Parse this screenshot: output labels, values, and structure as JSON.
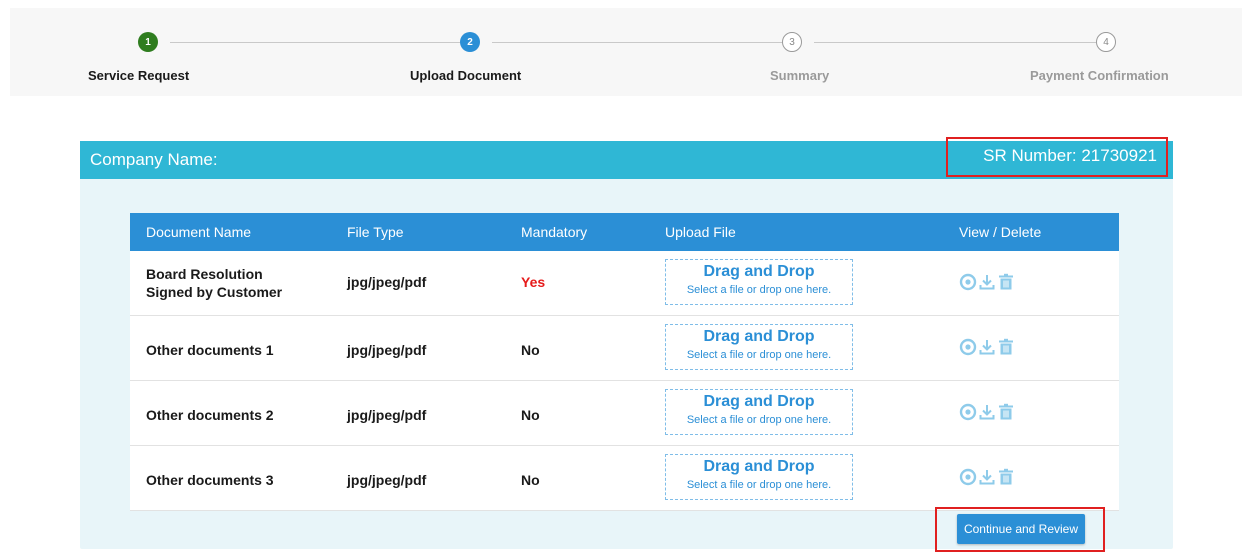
{
  "stepper": {
    "steps": [
      {
        "number": "1",
        "label": "Service Request",
        "state": "done"
      },
      {
        "number": "2",
        "label": "Upload Document",
        "state": "active"
      },
      {
        "number": "3",
        "label": "Summary",
        "state": "todo"
      },
      {
        "number": "4",
        "label": "Payment Confirmation",
        "state": "todo"
      }
    ]
  },
  "panel": {
    "company_label": "Company Name:",
    "sr_number": "SR Number: 21730921"
  },
  "table": {
    "headers": [
      "Document Name",
      "File Type",
      "Mandatory",
      "Upload File",
      "View / Delete"
    ],
    "rows": [
      {
        "doc_name": "Board Resolution Signed by Customer",
        "file_type": "jpg/jpeg/pdf",
        "mandatory": "Yes"
      },
      {
        "doc_name": "Other documents 1",
        "file_type": "jpg/jpeg/pdf",
        "mandatory": "No"
      },
      {
        "doc_name": "Other documents 2",
        "file_type": "jpg/jpeg/pdf",
        "mandatory": "No"
      },
      {
        "doc_name": "Other documents 3",
        "file_type": "jpg/jpeg/pdf",
        "mandatory": "No"
      }
    ],
    "dropzone": {
      "title": "Drag and Drop",
      "subtitle": "Select a file or drop one here."
    }
  },
  "actions": {
    "continue_label": "Continue and Review"
  },
  "colors": {
    "header_bar": "#2fb7d5",
    "table_header": "#2b8fd6",
    "mandatory_yes": "#e61b1b",
    "step_done": "#2f7d1f",
    "highlight_box": "#e02020"
  },
  "icons": [
    "view-icon",
    "download-icon",
    "delete-icon"
  ]
}
